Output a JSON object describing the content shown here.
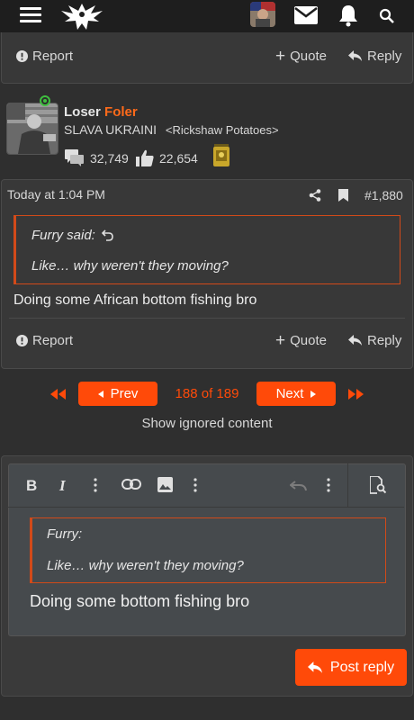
{
  "top_bar": {
    "menu_icon": "hamburger-icon",
    "logo": "phoenix-logo",
    "icons": [
      "avatar",
      "mail-icon",
      "bell-icon",
      "search-icon"
    ]
  },
  "prev_post_actions": {
    "report": "Report",
    "quote": "Quote",
    "reply": "Reply"
  },
  "user": {
    "first_name": "Loser",
    "last_name": "Foler",
    "title": "SLAVA UKRAINI",
    "tagline": "<Rickshaw Potatoes>",
    "messages": "32,749",
    "reactions": "22,654"
  },
  "post": {
    "time": "Today at 1:04 PM",
    "number": "#1,880",
    "quote_author": "Furry said:",
    "quote_text": "Like… why weren't they moving?",
    "body": "Doing some African bottom fishing bro",
    "report": "Report",
    "quote": "Quote",
    "reply": "Reply"
  },
  "pagination": {
    "prev": "Prev",
    "page": "188 of 189",
    "next": "Next",
    "show_ignored": "Show ignored content"
  },
  "editor": {
    "quote_author": "Furry:",
    "quote_text": "Like… why weren't they moving?",
    "text": "Doing some bottom fishing bro",
    "post_reply": "Post reply"
  },
  "colors": {
    "accent": "#ff4a09",
    "name_accent": "#ff6a1a",
    "online": "#3fbf3f"
  }
}
